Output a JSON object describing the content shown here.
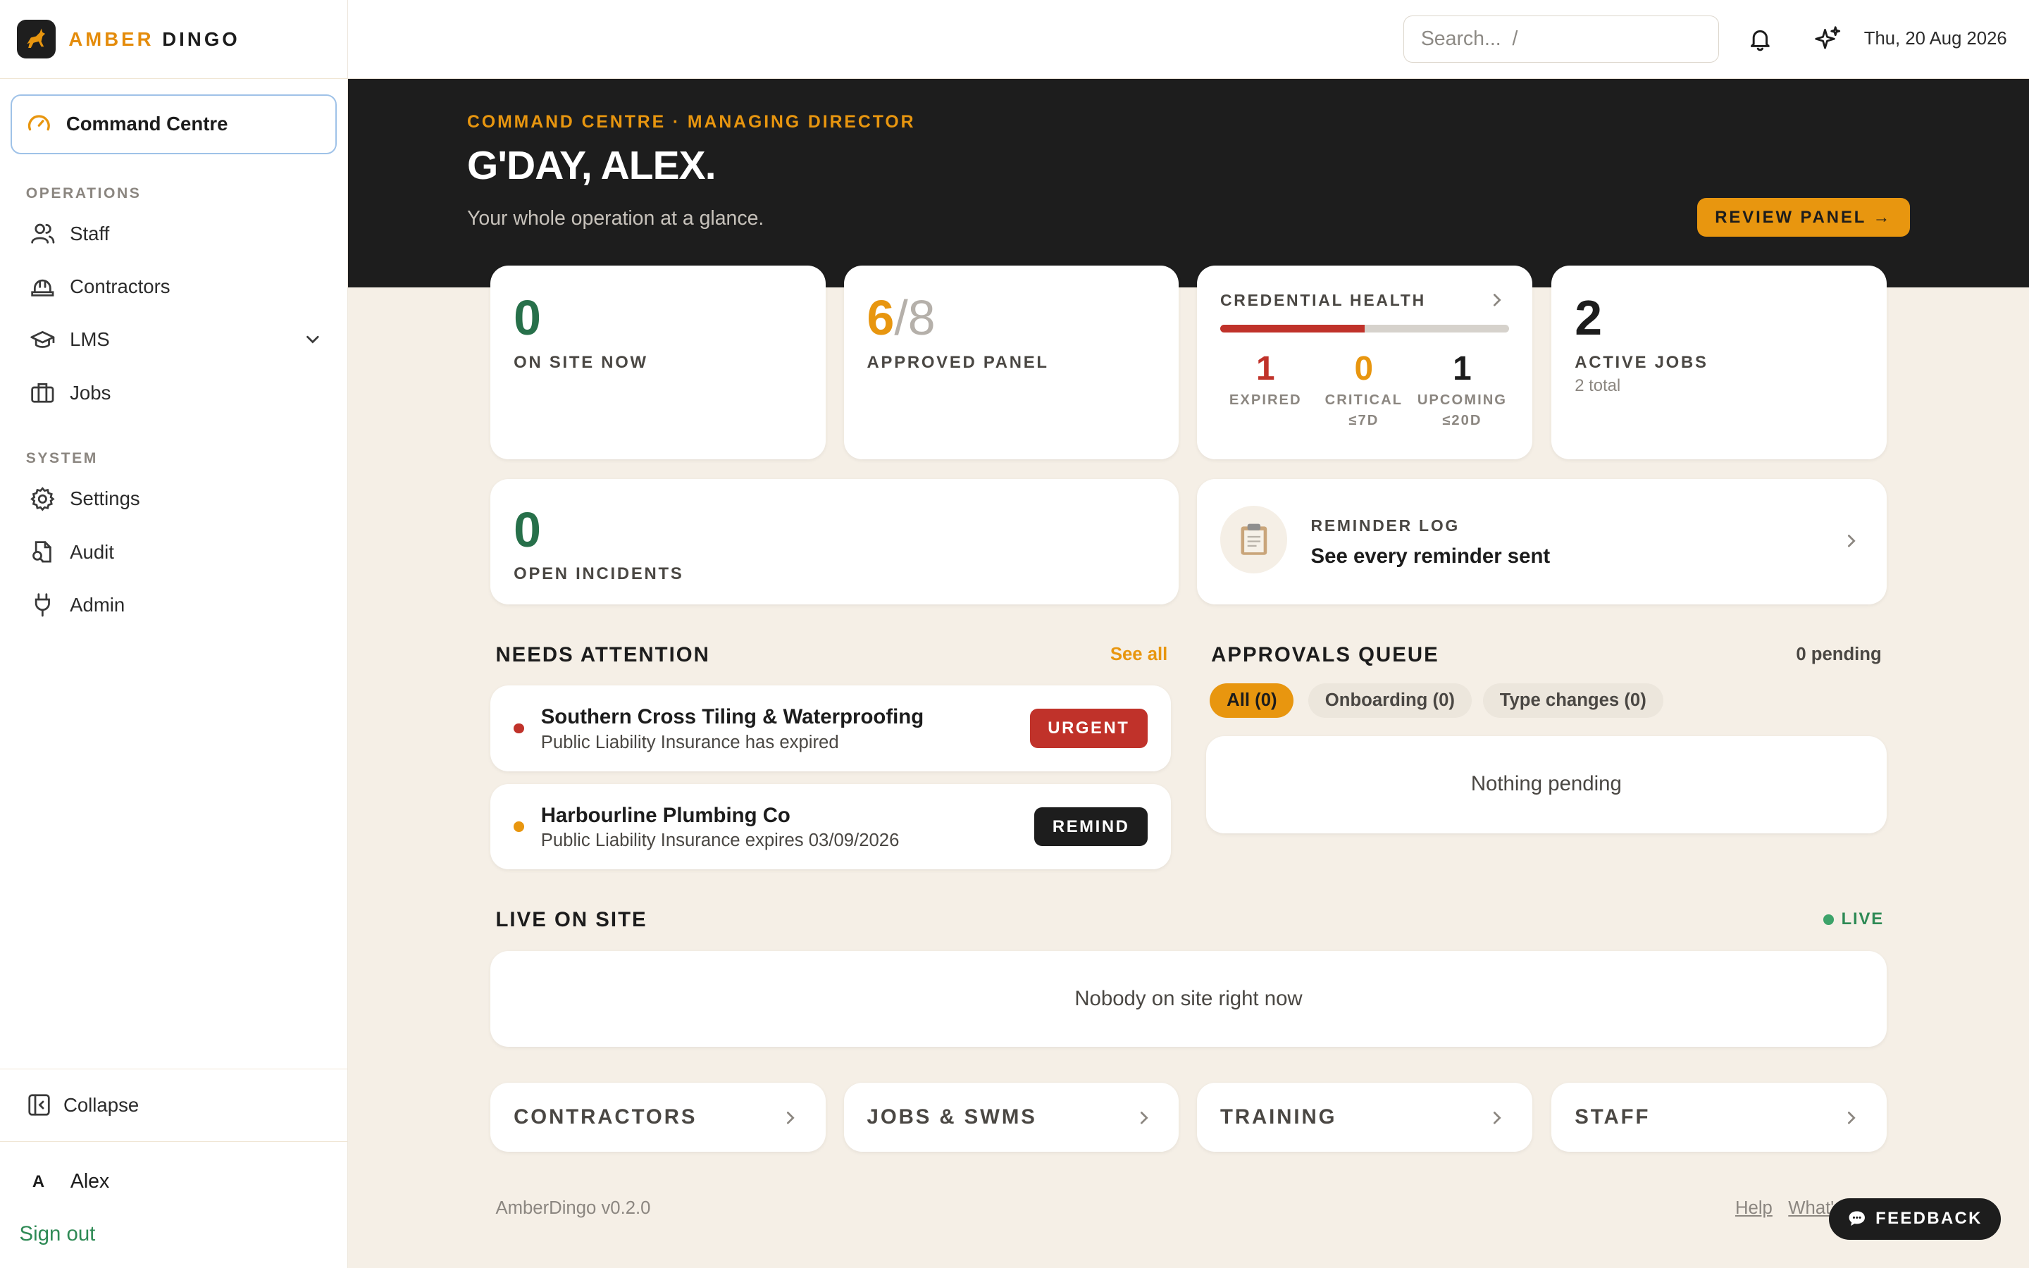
{
  "brand": {
    "name_first": "AMBER",
    "name_second": "DINGO",
    "accent": "#e8960f",
    "logo_icon": "dingo-icon"
  },
  "sidebar": {
    "active_item": {
      "label": "Command Centre",
      "icon": "gauge-icon"
    },
    "section_operations": "OPERATIONS",
    "operations": [
      {
        "label": "Staff",
        "icon": "users-icon"
      },
      {
        "label": "Contractors",
        "icon": "hard-hat-icon"
      },
      {
        "label": "LMS",
        "icon": "graduation-cap-icon"
      },
      {
        "label": "Jobs",
        "icon": "briefcase-icon"
      }
    ],
    "section_system": "SYSTEM",
    "system": [
      {
        "label": "Settings",
        "icon": "gear-icon"
      },
      {
        "label": "Audit",
        "icon": "file-search-icon"
      },
      {
        "label": "Admin",
        "icon": "plug-icon"
      }
    ],
    "collapse_label": "Collapse",
    "user": {
      "initial": "A",
      "name": "Alex"
    },
    "signout_label": "Sign out"
  },
  "topbar": {
    "search_placeholder": "Search...  /",
    "date": "Thu, 20 Aug 2026"
  },
  "hero": {
    "kicker": "COMMAND CENTRE · MANAGING DIRECTOR",
    "title": "G'DAY, ALEX.",
    "subtitle": "Your whole operation at a glance.",
    "review_button": "REVIEW PANEL →"
  },
  "stats": {
    "on_site": {
      "value": "0",
      "label": "ON SITE NOW"
    },
    "approved_panel": {
      "value": "6",
      "total": "/8",
      "label": "APPROVED PANEL"
    },
    "credential_health": {
      "title": "CREDENTIAL HEALTH",
      "bar_fraction": 0.5,
      "expired": {
        "value": "1",
        "label": "EXPIRED"
      },
      "critical": {
        "value": "0",
        "label1": "CRITICAL",
        "label2": "≤7D"
      },
      "upcoming": {
        "value": "1",
        "label1": "UPCOMING",
        "label2": "≤20D"
      }
    },
    "active_jobs": {
      "value": "2",
      "label": "ACTIVE JOBS",
      "sub": "2 total"
    },
    "open_incidents": {
      "value": "0",
      "label": "OPEN INCIDENTS"
    }
  },
  "reminder_log": {
    "kicker": "REMINDER LOG",
    "title": "See every reminder sent",
    "icon": "clipboard-icon"
  },
  "needs_attention": {
    "title": "NEEDS ATTENTION",
    "see_all": "See all",
    "items": [
      {
        "name": "Southern Cross Tiling & Waterproofing",
        "detail": "Public Liability Insurance has expired",
        "action": "URGENT",
        "dot_color": "#c0322a"
      },
      {
        "name": "Harbourline Plumbing Co",
        "detail": "Public Liability Insurance expires 03/09/2026",
        "action": "REMIND",
        "dot_color": "#e8960f"
      }
    ]
  },
  "approvals": {
    "title": "APPROVALS QUEUE",
    "pending": "0 pending",
    "tabs": [
      "All (0)",
      "Onboarding (0)",
      "Type changes (0)"
    ],
    "empty": "Nothing pending"
  },
  "live_on_site": {
    "title": "LIVE ON SITE",
    "status": "LIVE",
    "empty": "Nobody on site right now"
  },
  "quick_links": [
    "CONTRACTORS",
    "JOBS & SWMS",
    "TRAINING",
    "STAFF"
  ],
  "footer": {
    "version": "AmberDingo v0.2.0",
    "help": "Help",
    "whats_new": "What's new",
    "feedback": "FEEDBACK"
  }
}
